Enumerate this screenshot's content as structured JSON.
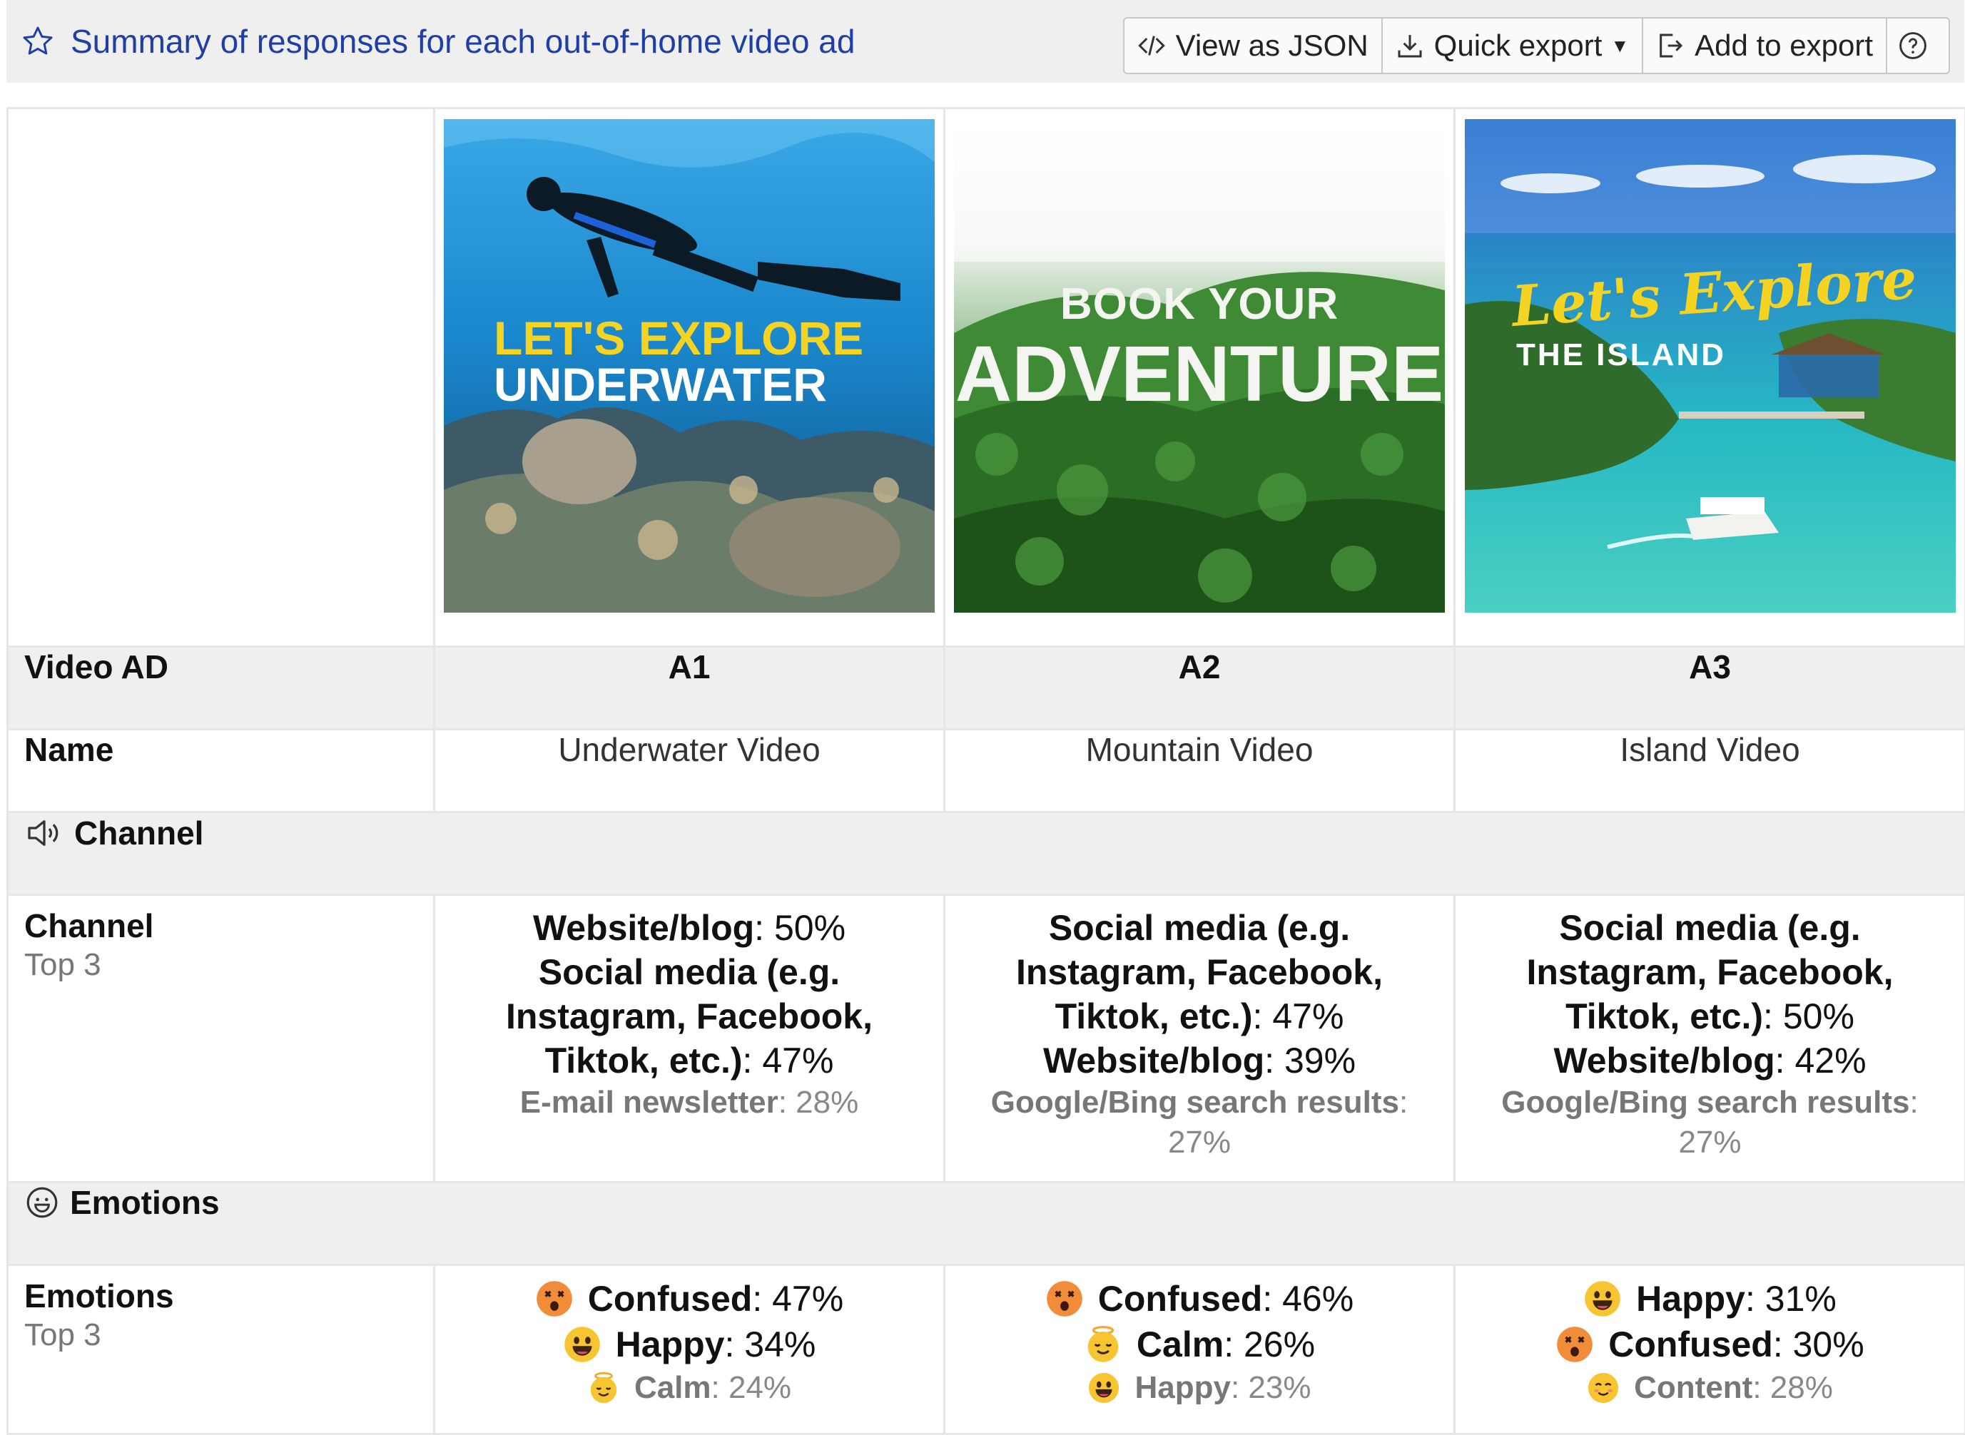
{
  "header": {
    "title": "Summary of responses for each out-of-home video ad",
    "star_icon": "star-outline-icon",
    "buttons": {
      "view_json": "View as JSON",
      "quick_export": "Quick export",
      "add_to_export": "Add to export",
      "help_icon": "help-circle-icon"
    }
  },
  "ads": [
    {
      "id": "A1",
      "name": "Underwater Video",
      "image": {
        "line1": "LET'S EXPLORE",
        "line2": "UNDERWATER",
        "accent": "#f5d323"
      },
      "channel": [
        {
          "label": "Website/blog",
          "value": "50%"
        },
        {
          "label": "Social media (e.g. Instagram, Facebook, Tiktok, etc.)",
          "value": "47%"
        },
        {
          "label": "E-mail newsletter",
          "value": "28%"
        }
      ],
      "emotions": [
        {
          "label": "Confused",
          "value": "47%",
          "icon": "confused-emoji-icon"
        },
        {
          "label": "Happy",
          "value": "34%",
          "icon": "happy-emoji-icon"
        },
        {
          "label": "Calm",
          "value": "24%",
          "icon": "calm-emoji-icon"
        }
      ]
    },
    {
      "id": "A2",
      "name": "Mountain Video",
      "image": {
        "line1": "BOOK YOUR",
        "line2": "ADVENTURE",
        "accent": "#ffffff"
      },
      "channel": [
        {
          "label": "Social media (e.g. Instagram, Facebook, Tiktok, etc.)",
          "value": "47%"
        },
        {
          "label": "Website/blog",
          "value": "39%"
        },
        {
          "label": "Google/Bing search results",
          "value": "27%"
        }
      ],
      "emotions": [
        {
          "label": "Confused",
          "value": "46%",
          "icon": "confused-emoji-icon"
        },
        {
          "label": "Calm",
          "value": "26%",
          "icon": "calm-emoji-icon"
        },
        {
          "label": "Happy",
          "value": "23%",
          "icon": "happy-emoji-icon"
        }
      ]
    },
    {
      "id": "A3",
      "name": "Island Video",
      "image": {
        "line1": "Let's Explore",
        "line2": "THE ISLAND",
        "accent": "#f5d323"
      },
      "channel": [
        {
          "label": "Social media (e.g. Instagram, Facebook, Tiktok, etc.)",
          "value": "50%"
        },
        {
          "label": "Website/blog",
          "value": "42%"
        },
        {
          "label": "Google/Bing search results",
          "value": "27%"
        }
      ],
      "emotions": [
        {
          "label": "Happy",
          "value": "31%",
          "icon": "happy-emoji-icon"
        },
        {
          "label": "Confused",
          "value": "30%",
          "icon": "confused-emoji-icon"
        },
        {
          "label": "Content",
          "value": "28%",
          "icon": "content-emoji-icon"
        }
      ]
    }
  ],
  "rows": {
    "video_ad": "Video AD",
    "name": "Name",
    "channel_section": "Channel",
    "channel_label": "Channel",
    "channel_sub": "Top 3",
    "emotions_section": "Emotions",
    "emotions_label": "Emotions",
    "emotions_sub": "Top 3"
  },
  "colors": {
    "title_blue": "#1f3fa8",
    "header_bg": "#efefef",
    "ocean": "#1a8fd6",
    "forest": "#2e7d2a",
    "lagoon": "#27b8c4"
  }
}
